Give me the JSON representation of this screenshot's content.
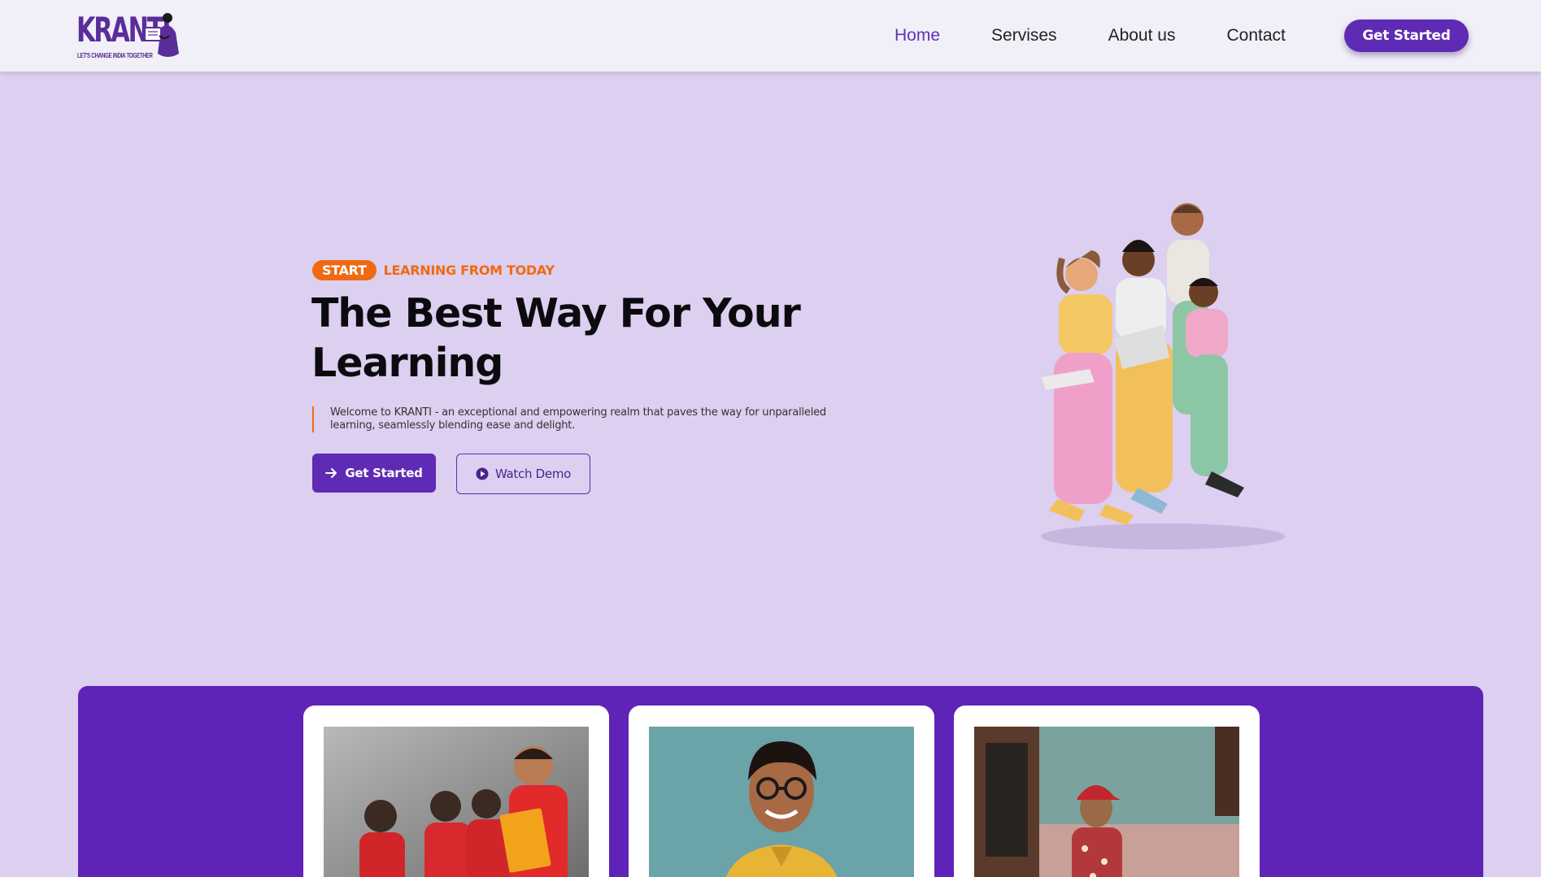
{
  "brand": {
    "name": "KRANTI",
    "tagline": "LET'S CHANGE INDIA TOGETHER",
    "color": "#5b2d9a"
  },
  "nav": {
    "items": [
      {
        "label": "Home",
        "active": true
      },
      {
        "label": "Servises",
        "active": false
      },
      {
        "label": "About us",
        "active": false
      },
      {
        "label": "Contact",
        "active": false
      }
    ],
    "cta_label": "Get Started"
  },
  "hero": {
    "badge": "START",
    "eyebrow": "LEARNING FROM TODAY",
    "title": "The Best Way For Your Learning",
    "description": "Welcome to KRANTI - an exceptional and empowering realm that paves the way for unparalleled learning, seamlessly blending ease and delight.",
    "primary_button": "Get Started",
    "secondary_button": "Watch Demo"
  },
  "cards": [
    {
      "image": "children-reading-books-photo"
    },
    {
      "image": "smiling-boy-with-glasses-photo"
    },
    {
      "image": "boy-in-red-cap-photo"
    }
  ],
  "colors": {
    "accent": "#5f2ab4",
    "orange": "#f06a12",
    "background": "#dccfef",
    "header": "#f1eff8"
  }
}
